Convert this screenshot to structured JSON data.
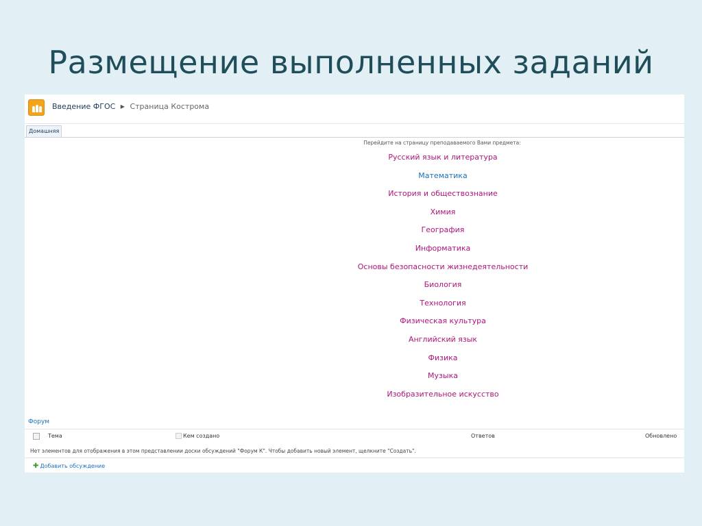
{
  "slide": {
    "title": "Размещение выполненных заданий"
  },
  "breadcrumb": {
    "site": "Введение ФГОС",
    "page": "Страница Кострома"
  },
  "nav": {
    "home_tab": "Домашняя"
  },
  "content": {
    "instruction": "Перейдите на страницу преподаваемого Вами предмета:",
    "subjects": [
      "Русский язык и литература",
      "Математика",
      "История и обществознание",
      "Химия",
      "География",
      "Информатика",
      "Основы безопасности жизнедеятельности",
      "Биология",
      "Технология",
      "Физическая культура",
      "Английский язык",
      "Физика",
      "Музыка",
      "Изобразительное искусство"
    ]
  },
  "forum": {
    "title": "Форум",
    "columns": {
      "topic": "Тема",
      "author": "Кем создано",
      "replies": "Ответов",
      "updated": "Обновлено"
    },
    "empty_message": "Нет элементов для отображения в этом представлении доски обсуждений \"Форум К\". Чтобы добавить новый элемент, щелкните \"Создать\".",
    "add_label": "Добавить обсуждение"
  },
  "colors": {
    "link_magenta": "#b0147a",
    "link_blue": "#1b70b8",
    "background": "#e2f0f6"
  }
}
